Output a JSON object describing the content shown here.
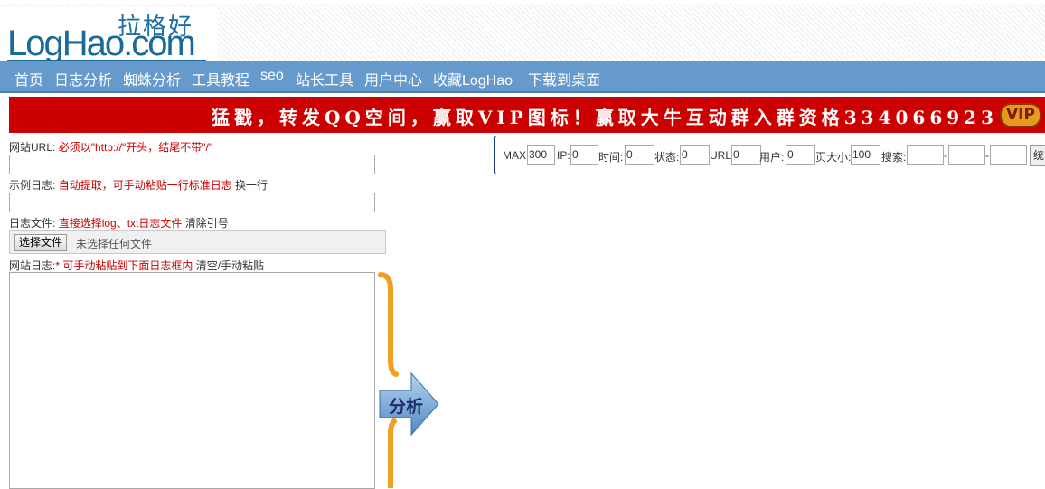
{
  "logo": {
    "cn": "拉格好",
    "en": "LogHao.com"
  },
  "nav": [
    "首页",
    "日志分析",
    "蜘蛛分析",
    "工具教程",
    "seo",
    "站长工具",
    "用户中心",
    "收藏LogHao",
    "下载到桌面"
  ],
  "banner": {
    "text": "猛戳，转发QQ空间，赢取VIP图标！赢取大牛互动群入群资格334066923",
    "badge": "VIP"
  },
  "form": {
    "url_label": "网站URL:",
    "url_hint": "必须以\"http://\"开头，结尾不带\"/\"",
    "url_value": "",
    "sample_label": "示例日志:",
    "sample_hint": "自动提取，可手动粘贴一行标准日志",
    "sample_link": "换一行",
    "sample_value": "",
    "file_label": "日志文件:",
    "file_hint": "直接选择log、txt日志文件",
    "file_link": "清除引号",
    "file_button": "选择文件",
    "file_status": "未选择任何文件",
    "log_label": "网站日志:",
    "log_star": "*",
    "log_hint": "可手动粘贴到下面日志框内",
    "log_link": "清空/手动粘贴",
    "analyze_label": "分析"
  },
  "filters": {
    "max_label": "MAX:",
    "max_value": "300",
    "ip_label": "IP:",
    "ip_value": "0",
    "time_label": "时间:",
    "time_value": "0",
    "status_label": "状态:",
    "status_value": "0",
    "url_label": "URL:",
    "url_value": "0",
    "user_label": "用户:",
    "user_value": "0",
    "pagesize_label": "页大小:",
    "pagesize_value": "100",
    "search_label": "搜索:",
    "search_sep1": "-",
    "search_sep2": "-",
    "submit_label": "统"
  },
  "colors": {
    "nav_bg": "#6699cc",
    "banner_bg": "#cc0000",
    "hint_red": "#cc0000",
    "brace_orange": "#f0a020",
    "arrow_blue": "#5b9bd5"
  }
}
